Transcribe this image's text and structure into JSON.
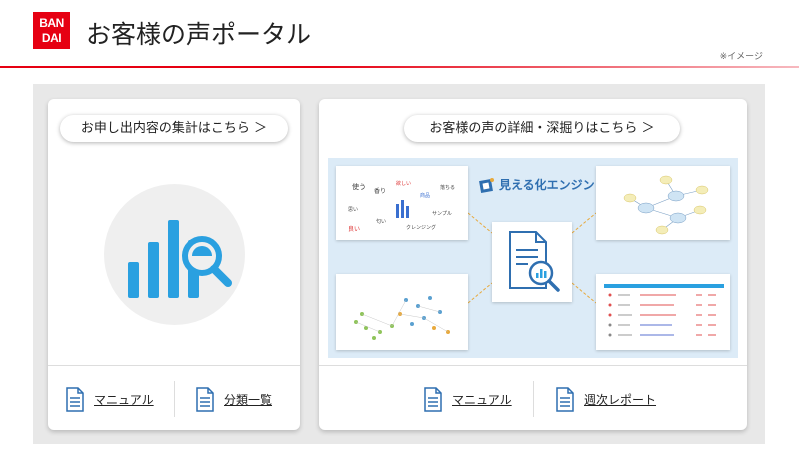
{
  "header": {
    "logo_line1": "BAN",
    "logo_line2": "DAI",
    "title": "お客様の声ポータル",
    "note": "※イメージ"
  },
  "left_card": {
    "pill_label": "お申し出内容の集計はこちら ＞",
    "links": [
      {
        "label": "マニュアル"
      },
      {
        "label": "分類一覧"
      }
    ]
  },
  "right_card": {
    "pill_label": "お客様の声の詳細・深掘りはこちら ＞",
    "engine_label": "見える化エンジン",
    "links": [
      {
        "label": "マニュアル"
      },
      {
        "label": "週次レポート"
      }
    ]
  },
  "colors": {
    "brand_red": "#e60012",
    "accent_blue": "#2aa0e0",
    "diagram_bg": "#dcebf7"
  }
}
